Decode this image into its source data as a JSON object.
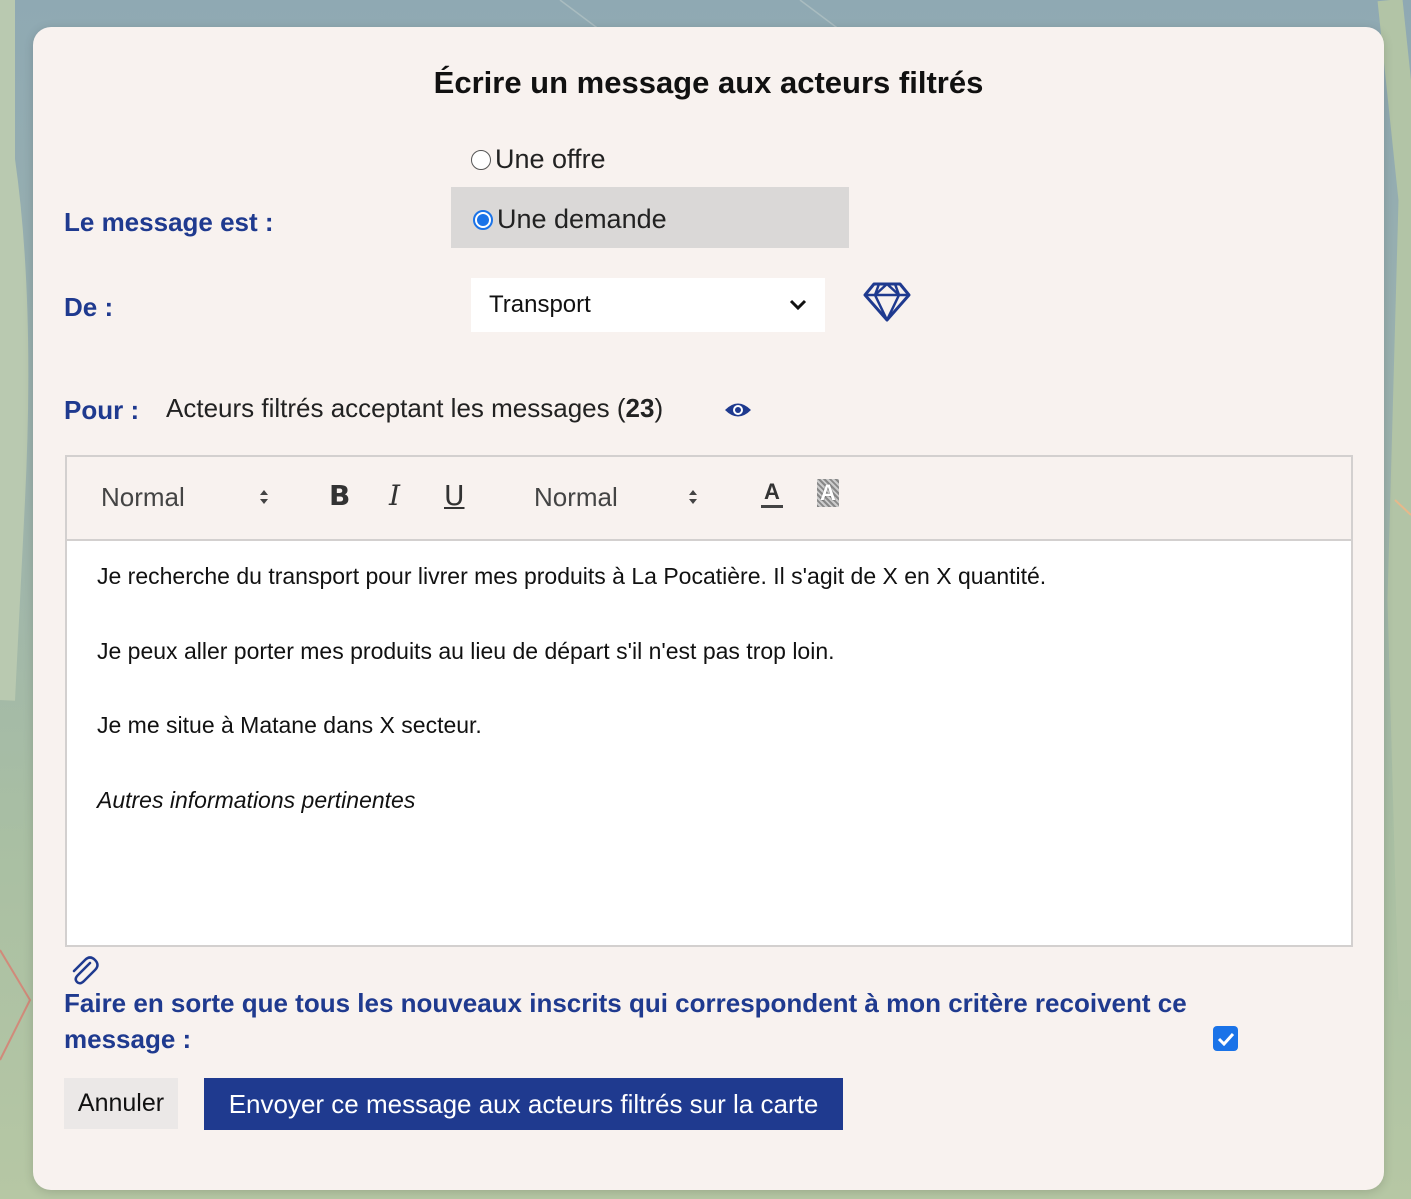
{
  "dialog": {
    "title": "Écrire un message aux acteurs filtrés"
  },
  "message_type": {
    "label": "Le message est :",
    "options": [
      {
        "label": "Une offre",
        "selected": false
      },
      {
        "label": "Une demande",
        "selected": true
      }
    ]
  },
  "from": {
    "label": "De :",
    "selected": "Transport",
    "icon": "diamond-icon"
  },
  "to": {
    "label": "Pour :",
    "text_prefix": "Acteurs filtrés acceptant les messages (",
    "count": "23",
    "text_suffix": ")",
    "icon": "eye-icon"
  },
  "editor": {
    "toolbar": {
      "header_select": "Normal",
      "bold": "B",
      "italic": "I",
      "underline": "U",
      "size_select": "Normal",
      "text_color": "A",
      "background_color": "A"
    },
    "content": {
      "line1": "Je recherche du transport pour livrer mes produits à La Pocatière. Il s'agit de X en X quantité.",
      "line2": "Je peux aller porter mes produits au lieu de départ s'il n'est pas trop loin.",
      "line3": "Je me situe à Matane dans X secteur.",
      "line4": "Autres informations pertinentes"
    }
  },
  "attachment": {
    "icon": "paperclip-icon"
  },
  "new_members": {
    "label": "Faire en sorte que tous les nouveaux inscrits qui correspondent à mon critère recoivent ce message :",
    "checked": true
  },
  "actions": {
    "cancel": "Annuler",
    "send": "Envoyer ce message aux acteurs filtrés sur la carte"
  },
  "colors": {
    "accent": "#1f3a8f",
    "radio_checked": "#1a73e8",
    "modal_bg": "#f8f2ef"
  }
}
